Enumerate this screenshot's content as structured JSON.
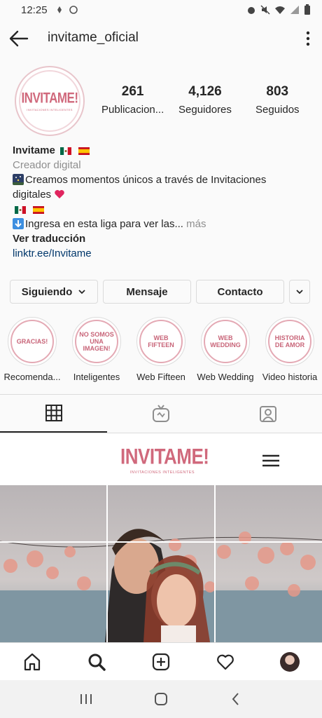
{
  "status_bar": {
    "time": "12:25"
  },
  "header": {
    "username": "invitame_oficial"
  },
  "profile": {
    "avatar_logo": "INVITAME!",
    "avatar_sub": "INVITACIONES INTELIGENTES",
    "stats": [
      {
        "value": "261",
        "label": "Publicacion..."
      },
      {
        "value": "4,126",
        "label": "Seguidores"
      },
      {
        "value": "803",
        "label": "Seguidos"
      }
    ],
    "name": "Invitame",
    "category": "Creador digital",
    "bio_line1": "Creamos momentos únicos a través de Invitaciones",
    "bio_line2": "digitales",
    "bio_link_line": "Ingresa en esta liga para ver las...",
    "more": " más",
    "translate": "Ver traducción",
    "link": "linktr.ee/Invitame"
  },
  "actions": {
    "following": "Siguiendo",
    "message": "Mensaje",
    "contact": "Contacto"
  },
  "highlights": [
    {
      "cover": "GRACIAS!",
      "label": "Recomenda..."
    },
    {
      "cover": "NO SOMOS UNA IMAGEN!",
      "label": "Inteligentes"
    },
    {
      "cover": "WEB FIFTEEN",
      "label": "Web Fifteen"
    },
    {
      "cover": "WEB WEDDING",
      "label": "Web Wedding"
    },
    {
      "cover": "HISTORIA DE AMOR",
      "label": "Video historia"
    }
  ],
  "post": {
    "logo": "INVITAME!",
    "logo_sub": "INVITACIONES INTELIGENTES"
  },
  "colors": {
    "brand_pink": "#d0697c",
    "link_blue": "#00376b"
  }
}
